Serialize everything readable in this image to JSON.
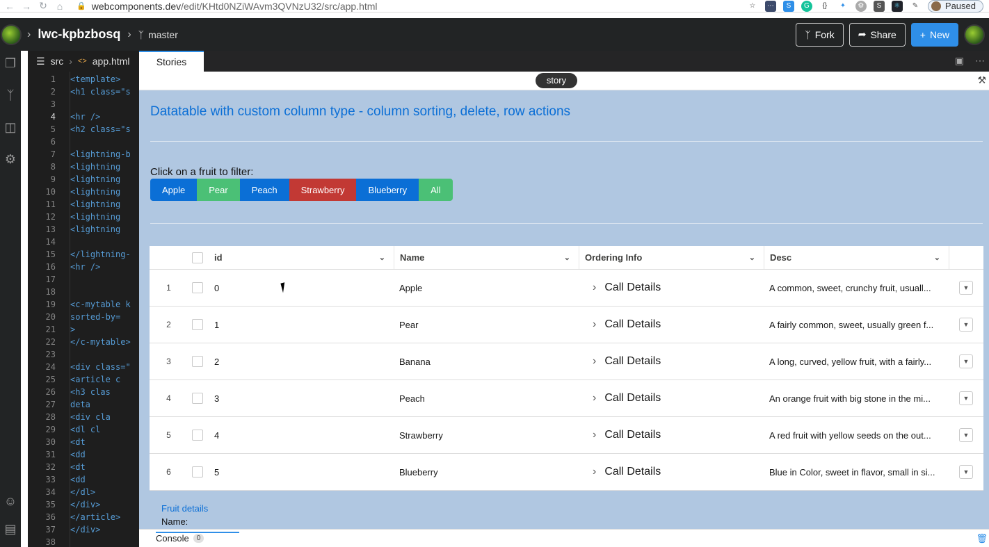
{
  "browser": {
    "url_host": "webcomponents.dev",
    "url_path": "/edit/KHtd0NZiWAvm3QVNzU32/src/app.html",
    "profile_status": "Paused"
  },
  "header": {
    "project_name": "lwc-kpbzbosq",
    "branch": "master",
    "fork_label": "Fork",
    "share_label": "Share",
    "new_label": "New"
  },
  "editor": {
    "folder": "src",
    "file": "app.html",
    "lines": [
      {
        "n": "1",
        "code": "<template>"
      },
      {
        "n": "2",
        "code": "  <h1 class=\"s"
      },
      {
        "n": "3",
        "code": ""
      },
      {
        "n": "4",
        "code": "  <hr />"
      },
      {
        "n": "5",
        "code": "  <h2 class=\"s"
      },
      {
        "n": "6",
        "code": ""
      },
      {
        "n": "7",
        "code": "  <lightning-b"
      },
      {
        "n": "8",
        "code": "    <lightning"
      },
      {
        "n": "9",
        "code": "    <lightning"
      },
      {
        "n": "10",
        "code": "    <lightning"
      },
      {
        "n": "11",
        "code": "    <lightning"
      },
      {
        "n": "12",
        "code": "    <lightning"
      },
      {
        "n": "13",
        "code": "    <lightning"
      },
      {
        "n": "14",
        "code": ""
      },
      {
        "n": "15",
        "code": "  </lightning-"
      },
      {
        "n": "16",
        "code": "  <hr />"
      },
      {
        "n": "17",
        "code": ""
      },
      {
        "n": "18",
        "code": ""
      },
      {
        "n": "19",
        "code": "  <c-mytable k"
      },
      {
        "n": "20",
        "code": "    sorted-by="
      },
      {
        "n": "21",
        "code": "    >"
      },
      {
        "n": "22",
        "code": "  </c-mytable>"
      },
      {
        "n": "23",
        "code": ""
      },
      {
        "n": "24",
        "code": "  <div class=\""
      },
      {
        "n": "25",
        "code": "    <article c"
      },
      {
        "n": "26",
        "code": "      <h3 clas"
      },
      {
        "n": "27",
        "code": "        deta"
      },
      {
        "n": "28",
        "code": "      <div cla"
      },
      {
        "n": "29",
        "code": "        <dl cl"
      },
      {
        "n": "30",
        "code": "          <dt"
      },
      {
        "n": "31",
        "code": "          <dd"
      },
      {
        "n": "32",
        "code": "          <dt"
      },
      {
        "n": "33",
        "code": "          <dd"
      },
      {
        "n": "34",
        "code": "        </dl>"
      },
      {
        "n": "35",
        "code": "      </div>"
      },
      {
        "n": "36",
        "code": "    </article>"
      },
      {
        "n": "37",
        "code": "  </div>"
      },
      {
        "n": "38",
        "code": ""
      }
    ]
  },
  "preview": {
    "tab_label": "Stories",
    "story_pill": "story",
    "title": "Datatable with custom column type - column sorting, delete, row actions",
    "filter_label": "Click on a fruit to filter:",
    "filter_buttons": [
      {
        "label": "Apple",
        "color": "#0b6fd6"
      },
      {
        "label": "Pear",
        "color": "#4bc076"
      },
      {
        "label": "Peach",
        "color": "#0b6fd6"
      },
      {
        "label": "Strawberry",
        "color": "#c23934"
      },
      {
        "label": "Blueberry",
        "color": "#0b6fd6"
      },
      {
        "label": "All",
        "color": "#4bc076"
      }
    ],
    "table": {
      "columns": [
        "id",
        "Name",
        "Ordering Info",
        "Desc"
      ],
      "rows": [
        {
          "num": "1",
          "id": "0",
          "name": "Apple",
          "order": "Call Details",
          "desc": "A common, sweet, crunchy fruit, usuall..."
        },
        {
          "num": "2",
          "id": "1",
          "name": "Pear",
          "order": "Call Details",
          "desc": "A fairly common, sweet, usually green f..."
        },
        {
          "num": "3",
          "id": "2",
          "name": "Banana",
          "order": "Call Details",
          "desc": "A long, curved, yellow fruit, with a fairly..."
        },
        {
          "num": "4",
          "id": "3",
          "name": "Peach",
          "order": "Call Details",
          "desc": "An orange fruit with big stone in the mi..."
        },
        {
          "num": "5",
          "id": "4",
          "name": "Strawberry",
          "order": "Call Details",
          "desc": "A red fruit with yellow seeds on the out..."
        },
        {
          "num": "6",
          "id": "5",
          "name": "Blueberry",
          "order": "Call Details",
          "desc": "Blue in Color, sweet in flavor, small in si..."
        }
      ]
    },
    "fruit_details_title": "Fruit details",
    "name_label": "Name:",
    "console_label": "Console",
    "console_count": "0"
  }
}
